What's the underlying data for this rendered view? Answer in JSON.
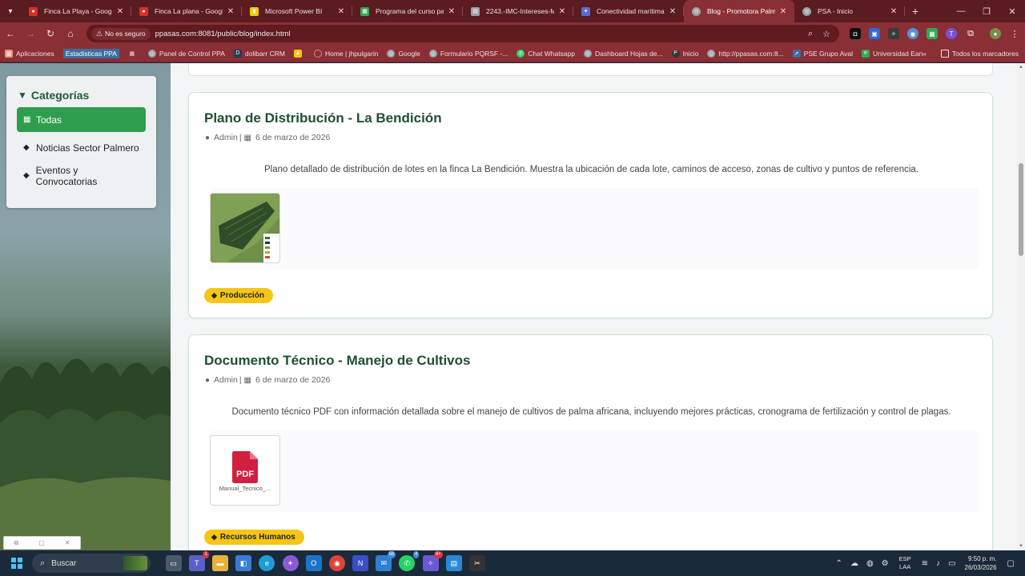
{
  "browser": {
    "tabs": [
      {
        "title": "Finca La Playa - Google M",
        "fav_color": "#d93025",
        "fav_icon": "map-pin-icon"
      },
      {
        "title": "Finca La plana - Google M",
        "fav_color": "#d93025",
        "fav_icon": "map-pin-icon"
      },
      {
        "title": "Microsoft Power BI",
        "fav_color": "#f2c811",
        "fav_icon": "powerbi-icon"
      },
      {
        "title": "Programa del curso para l",
        "fav_color": "#34a853",
        "fav_icon": "sheets-icon"
      },
      {
        "title": "2243.-IMC-Intereses-Mar",
        "fav_color": "#9aa0a6",
        "fav_icon": "doc-icon"
      },
      {
        "title": "Conectividad marítima e",
        "fav_color": "#5b6bd5",
        "fav_icon": "ai-icon"
      },
      {
        "title": "Blog - Promotora Palmer",
        "fav_color": "#9aa0a6",
        "fav_icon": "globe-icon",
        "active": true
      },
      {
        "title": "PSA - Inicio",
        "fav_color": "#9aa0a6",
        "fav_icon": "globe-icon"
      }
    ],
    "security_label": "No es seguro",
    "url": "ppasas.com:8081/public/blog/index.html",
    "bookmarks": [
      {
        "label": "Aplicaciones",
        "color": "#f28b82"
      },
      {
        "label": "Estadisticas PPA",
        "color": "#3a6fa0",
        "highlight": true
      },
      {
        "label": "",
        "color": "#cfcfcf"
      },
      {
        "label": "Panel de Control PPA",
        "color": "#9aa0a6"
      },
      {
        "label": "dolibarr CRM",
        "color": "#263c5c"
      },
      {
        "label": "",
        "color": "#f2c811"
      },
      {
        "label": "Home | jhpulgarin",
        "color": "#8a2f35"
      },
      {
        "label": "Google",
        "color": "#9aa0a6"
      },
      {
        "label": "Formulario PQRSF -...",
        "color": "#9aa0a6"
      },
      {
        "label": "Chat Whatsapp",
        "color": "#25d366"
      },
      {
        "label": "Dashboard Hojas de...",
        "color": "#9aa0a6"
      },
      {
        "label": "Inicio",
        "color": "#333333"
      },
      {
        "label": "http://ppasas.com:8...",
        "color": "#9aa0a6"
      },
      {
        "label": "PSE Grupo Aval",
        "color": "#3a6fa0"
      },
      {
        "label": "Universidad Ean",
        "color": "#34a853"
      }
    ],
    "all_bookmarks_label": "Todos los marcadores"
  },
  "sidebar": {
    "title": "Categorías",
    "items": [
      {
        "label": "Todas",
        "icon": "table-icon",
        "active": true
      },
      {
        "label": "Noticias Sector Palmero",
        "icon": "tag-icon"
      },
      {
        "label": "Eventos y Convocatorias",
        "icon": "tag-icon"
      }
    ]
  },
  "posts": [
    {
      "title": "Plano de Distribución - La Bendición",
      "author": "Admin",
      "date": "6 de marzo de 2026",
      "description": "Plano detallado de distribución de lotes en la finca La Bendición. Muestra la ubicación de cada lote, caminos de acceso, zonas de cultivo y puntos de referencia.",
      "attachment_type": "image",
      "tag": "Producción"
    },
    {
      "title": "Documento Técnico - Manejo de Cultivos",
      "author": "Admin",
      "date": "6 de marzo de 2026",
      "description": "Documento técnico PDF con información detallada sobre el manejo de cultivos de palma africana, incluyendo mejores prácticas, cronograma de fertilización y control de plagas.",
      "attachment_type": "pdf",
      "attachment_name": "Manual_Tecnico_...",
      "pdf_label": "PDF",
      "tag": "Recursos Humanos"
    }
  ],
  "taskbar": {
    "search_placeholder": "Buscar",
    "lang_line1": "ESP",
    "lang_line2": "LAA",
    "time": "9:50 p. m.",
    "date": "26/03/2026",
    "badges": {
      "teams": "1",
      "mail": "58",
      "whatsapp": "4",
      "chat": "9+"
    }
  },
  "colors": {
    "brand_green": "#1e4f33",
    "active_green": "#2e9e4e",
    "tag_yellow": "#f5c518",
    "pdf_red": "#d11f3f"
  }
}
